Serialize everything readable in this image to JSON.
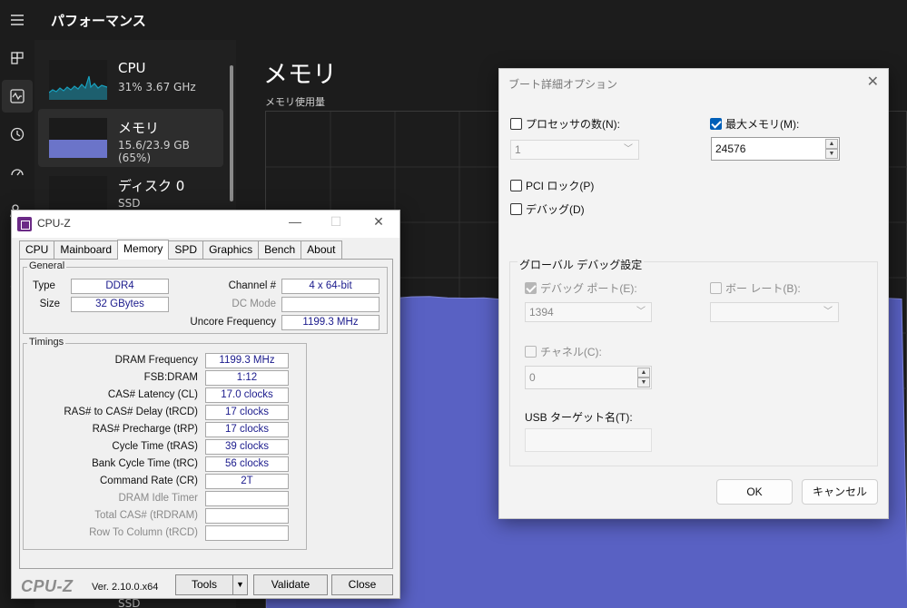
{
  "task_manager": {
    "title": "パフォーマンス",
    "items": [
      {
        "name": "CPU",
        "detail": "31%  3.67 GHz"
      },
      {
        "name": "メモリ",
        "detail": "15.6/23.9 GB (65%)"
      },
      {
        "name": "ディスク 0",
        "detail": "SSD"
      }
    ],
    "hidden_item_detail": "SSD",
    "main": {
      "heading": "メモリ",
      "usage_label": "メモリ使用量"
    },
    "memory_usage_percent": 65,
    "colors": {
      "accent": "#6b74c9",
      "graph_fill": "#5961c3",
      "cpu_line": "#17a2c0"
    },
    "rail_icons": [
      "hamburger-menu-icon",
      "processes-icon",
      "performance-icon",
      "app-history-icon",
      "startup-apps-icon",
      "users-icon",
      "details-icon",
      "services-icon"
    ]
  },
  "cpuz": {
    "title": "CPU-Z",
    "tabs": [
      "CPU",
      "Mainboard",
      "Memory",
      "SPD",
      "Graphics",
      "Bench",
      "About"
    ],
    "active_tab": "Memory",
    "general": {
      "title": "General",
      "type_label": "Type",
      "type": "DDR4",
      "size_label": "Size",
      "size": "32 GBytes",
      "channel_label": "Channel #",
      "channel": "4 x 64-bit",
      "dc_mode_label": "DC Mode",
      "dc_mode": "",
      "uncore_label": "Uncore Frequency",
      "uncore": "1199.3 MHz"
    },
    "timings": {
      "title": "Timings",
      "rows": [
        {
          "label": "DRAM Frequency",
          "value": "1199.3 MHz",
          "enabled": true
        },
        {
          "label": "FSB:DRAM",
          "value": "1:12",
          "enabled": true
        },
        {
          "label": "CAS# Latency (CL)",
          "value": "17.0 clocks",
          "enabled": true
        },
        {
          "label": "RAS# to CAS# Delay (tRCD)",
          "value": "17 clocks",
          "enabled": true
        },
        {
          "label": "RAS# Precharge (tRP)",
          "value": "17 clocks",
          "enabled": true
        },
        {
          "label": "Cycle Time (tRAS)",
          "value": "39 clocks",
          "enabled": true
        },
        {
          "label": "Bank Cycle Time (tRC)",
          "value": "56 clocks",
          "enabled": true
        },
        {
          "label": "Command Rate (CR)",
          "value": "2T",
          "enabled": true
        },
        {
          "label": "DRAM Idle Timer",
          "value": "",
          "enabled": false
        },
        {
          "label": "Total CAS# (tRDRAM)",
          "value": "",
          "enabled": false
        },
        {
          "label": "Row To Column (tRCD)",
          "value": "",
          "enabled": false
        }
      ]
    },
    "footer": {
      "logo": "CPU-Z",
      "version": "Ver. 2.10.0.x64",
      "tools": "Tools",
      "validate": "Validate",
      "close": "Close"
    }
  },
  "boot_options": {
    "title": "ブート詳細オプション",
    "num_processors_label": "プロセッサの数(N):",
    "num_processors_checked": false,
    "num_processors_value": "1",
    "max_memory_label": "最大メモリ(M):",
    "max_memory_checked": true,
    "max_memory_value": "24576",
    "pci_lock_label": "PCI ロック(P)",
    "debug_label": "デバッグ(D)",
    "global_debug_title": "グローバル デバッグ設定",
    "debug_port_label": "デバッグ ポート(E):",
    "debug_port_value": "1394",
    "baud_rate_label": "ボー レート(B):",
    "baud_rate_value": "",
    "channel_label": "チャネル(C):",
    "channel_value": "0",
    "usb_target_label": "USB ターゲット名(T):",
    "usb_target_value": "",
    "ok": "OK",
    "cancel": "キャンセル"
  }
}
